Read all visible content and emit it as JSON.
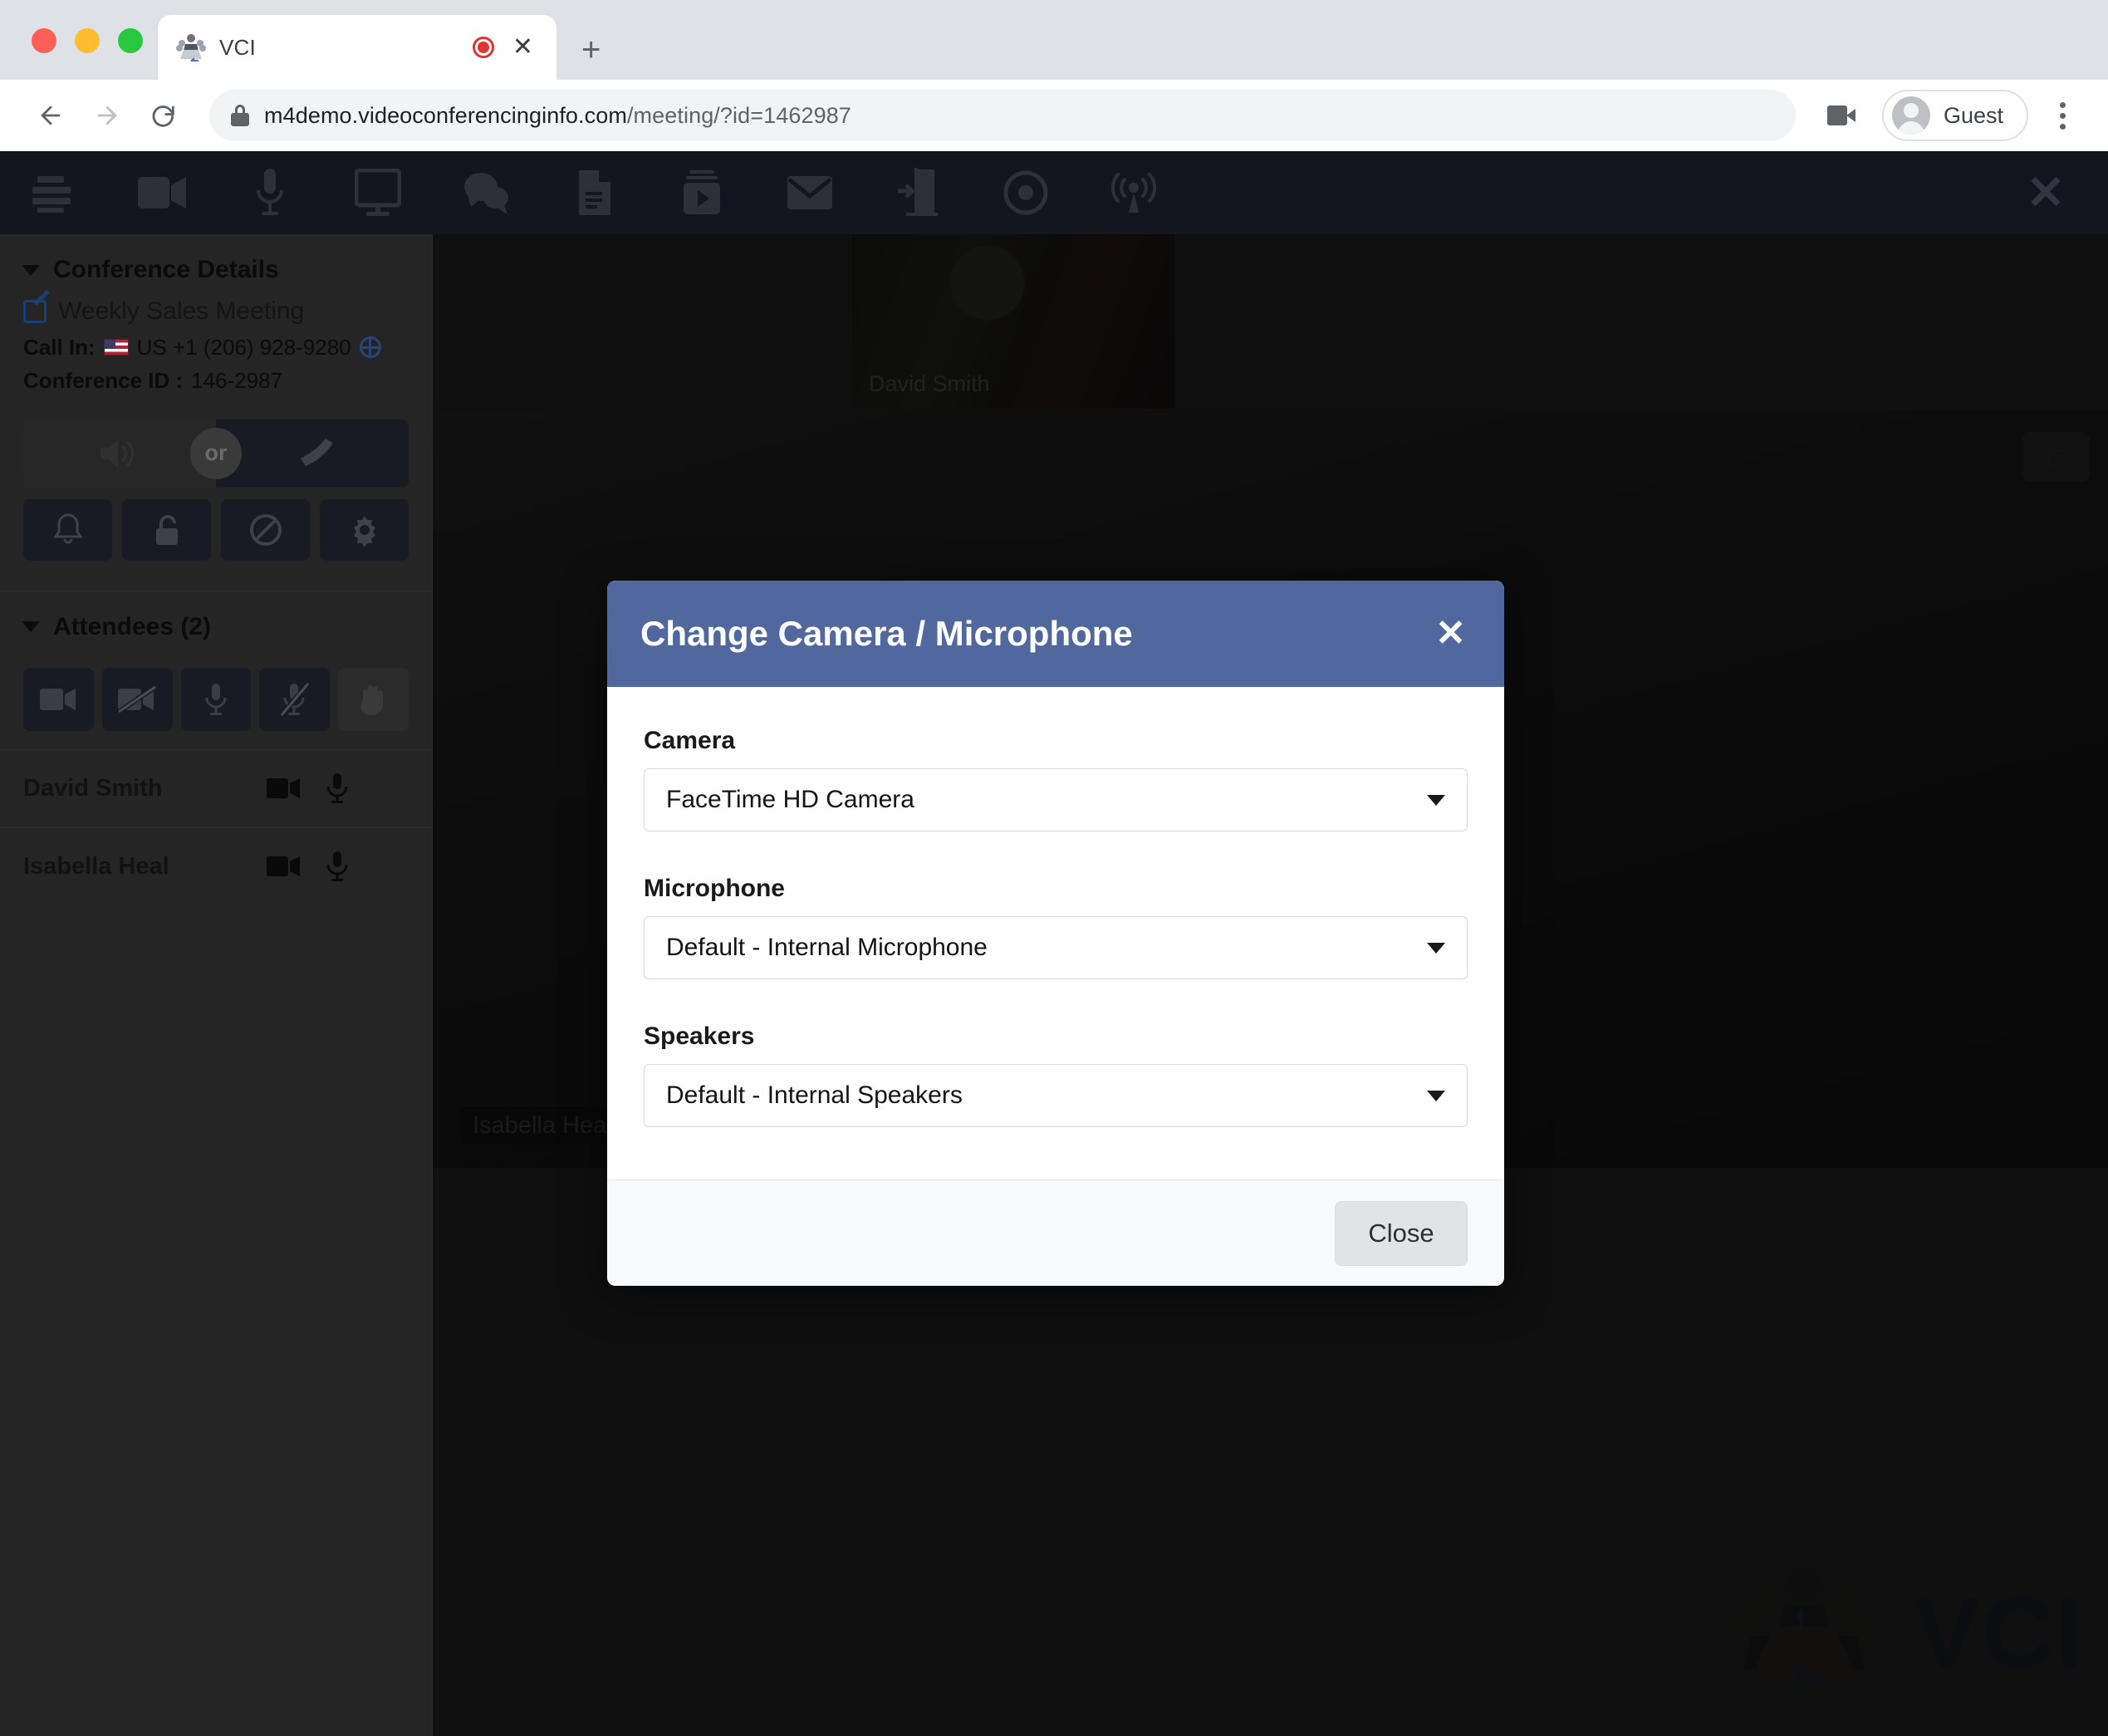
{
  "browser": {
    "tab": {
      "title": "VCI",
      "favicon_icon": "conference-table-icon",
      "recording_icon": "recording-dot-icon",
      "close_icon": "close-icon"
    },
    "new_tab_icon": "plus-icon",
    "nav": {
      "back_icon": "arrow-left-icon",
      "forward_icon": "arrow-right-icon",
      "reload_icon": "reload-icon"
    },
    "omnibox": {
      "lock_icon": "lock-icon",
      "url_domain": "m4demo.videoconferencinginfo.com",
      "url_path": "/meeting/?id=1462987"
    },
    "camera_icon": "video-camera-icon",
    "profile": {
      "name": "Guest",
      "avatar_icon": "person-avatar-icon"
    },
    "menu_icon": "kebab-menu-icon"
  },
  "app_toolbar": {
    "items": [
      {
        "name": "menu",
        "icon": "hamburger-menu-icon"
      },
      {
        "name": "camera",
        "icon": "video-camera-icon"
      },
      {
        "name": "microphone",
        "icon": "microphone-icon"
      },
      {
        "name": "share-screen",
        "icon": "monitor-icon"
      },
      {
        "name": "chat",
        "icon": "chat-bubbles-icon"
      },
      {
        "name": "documents",
        "icon": "document-icon"
      },
      {
        "name": "media",
        "icon": "video-player-icon"
      },
      {
        "name": "email",
        "icon": "envelope-icon"
      },
      {
        "name": "leave",
        "icon": "exit-door-icon"
      },
      {
        "name": "record",
        "icon": "record-circle-icon"
      },
      {
        "name": "broadcast",
        "icon": "broadcast-antenna-icon"
      }
    ],
    "close_icon": "close-x-icon"
  },
  "sidebar": {
    "conference": {
      "section_title": "Conference Details",
      "caret_icon": "caret-down-icon",
      "meeting_name": "Weekly Sales Meeting",
      "edit_icon": "edit-pencil-icon",
      "call_in_label": "Call In:",
      "flag_icon": "us-flag-icon",
      "call_in_number": "US +1 (206) 928-9280",
      "globe_icon": "globe-icon",
      "conference_id_label": "Conference ID :",
      "conference_id": "146-2987"
    },
    "audio_row": {
      "speaker_icon": "speaker-volume-icon",
      "or_label": "or",
      "phone_icon": "phone-handset-icon"
    },
    "icon_row": [
      {
        "name": "notifications",
        "icon": "bell-icon"
      },
      {
        "name": "lock-meeting",
        "icon": "unlocked-padlock-icon"
      },
      {
        "name": "block",
        "icon": "no-entry-icon"
      },
      {
        "name": "settings",
        "icon": "gear-icon"
      }
    ],
    "attendees": {
      "section_title": "Attendees (2)",
      "caret_icon": "caret-down-icon",
      "controls": [
        {
          "name": "enable-all-video",
          "icon": "video-camera-icon"
        },
        {
          "name": "disable-all-video",
          "icon": "video-camera-off-icon"
        },
        {
          "name": "unmute-all",
          "icon": "microphone-icon"
        },
        {
          "name": "mute-all",
          "icon": "microphone-muted-icon"
        },
        {
          "name": "raise-hand",
          "icon": "raised-hand-icon"
        }
      ],
      "rows": [
        {
          "name": "David Smith",
          "video_icon": "video-camera-icon",
          "mic_icon": "microphone-icon"
        },
        {
          "name": "Isabella Heal",
          "video_icon": "video-camera-icon",
          "mic_icon": "microphone-icon"
        }
      ]
    }
  },
  "stage": {
    "thumbnail": {
      "label": "David Smith"
    },
    "main_video": {
      "label": "Isabella Heal",
      "corner_button_icon": "layout-toggle-icon"
    },
    "watermark": {
      "logo_icon": "conference-table-icon",
      "text": "VCI"
    }
  },
  "modal": {
    "title": "Change Camera / Microphone",
    "close_icon": "close-x-icon",
    "fields": [
      {
        "label": "Camera",
        "value": "FaceTime HD Camera",
        "caret_icon": "caret-down-icon"
      },
      {
        "label": "Microphone",
        "value": "Default - Internal Microphone",
        "caret_icon": "caret-down-icon"
      },
      {
        "label": "Speakers",
        "value": "Default - Internal Speakers",
        "caret_icon": "caret-down-icon"
      }
    ],
    "close_button": "Close"
  },
  "colors": {
    "modal_header": "#51689f",
    "app_toolbar": "#14161f",
    "sidebar": "#252525",
    "stage": "#1d1d1d",
    "brand_navy": "#10192e"
  }
}
